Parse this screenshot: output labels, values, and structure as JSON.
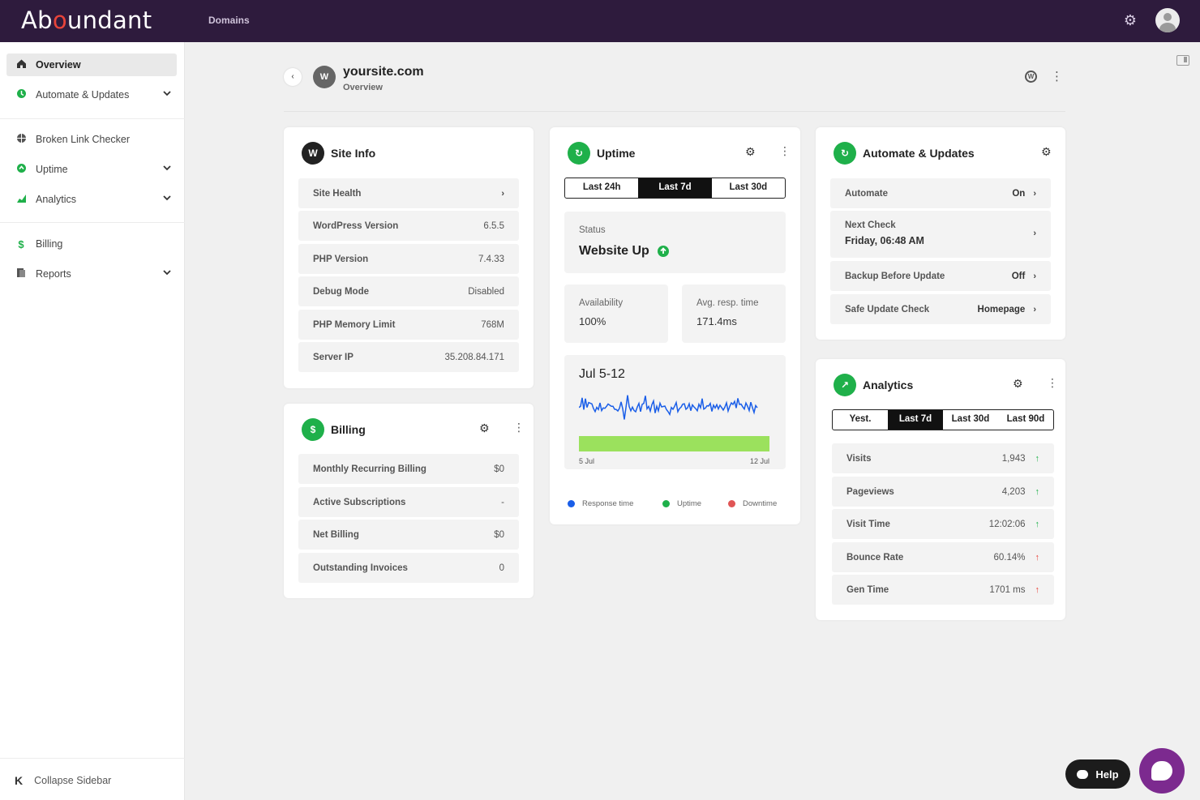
{
  "topbar": {
    "logo": "Abundant",
    "logo_pre": "Ab",
    "logo_o": "o",
    "logo_post": "undant",
    "nav": "Domains",
    "gear": "⚙"
  },
  "sidebar": {
    "overview": "Overview",
    "automate": "Automate & Updates",
    "blc": "Broken Link Checker",
    "uptime": "Uptime",
    "analytics": "Analytics",
    "billing": "Billing",
    "reports": "Reports",
    "collapse": "Collapse Sidebar"
  },
  "header": {
    "back": "‹",
    "avatar": "W",
    "site": "yoursite.com",
    "sub": "Overview",
    "kebab": "⋮"
  },
  "site_info": {
    "title": "Site Info",
    "rows": [
      {
        "label": "Site Health",
        "value": ""
      },
      {
        "label": "WordPress Version",
        "value": "6.5.5"
      },
      {
        "label": "PHP Version",
        "value": "7.4.33"
      },
      {
        "label": "Debug Mode",
        "value": "Disabled"
      },
      {
        "label": "PHP Memory Limit",
        "value": "768M"
      },
      {
        "label": "Server IP",
        "value": "35.208.84.171"
      }
    ]
  },
  "billing": {
    "title": "Billing",
    "rows": [
      {
        "label": "Monthly Recurring Billing",
        "value": "$0"
      },
      {
        "label": "Active Subscriptions",
        "value": "-"
      },
      {
        "label": "Net Billing",
        "value": "$0"
      },
      {
        "label": "Outstanding Invoices",
        "value": "0"
      }
    ]
  },
  "uptime": {
    "title": "Uptime",
    "tabs": [
      "Last 24h",
      "Last 7d",
      "Last 30d"
    ],
    "active_tab": "Last 7d",
    "status_label": "Status",
    "status_value": "Website Up",
    "availability_label": "Availability",
    "availability_value": "100%",
    "resp_label": "Avg. resp. time",
    "resp_value": "171.4ms",
    "chart_title": "Jul 5-12",
    "x_start": "5 Jul",
    "x_end": "12 Jul",
    "legend": [
      "Response time",
      "Uptime",
      "Downtime"
    ],
    "colors": {
      "response": "#1a5ee8",
      "uptime": "#9be15d",
      "downtime": "#e05555"
    }
  },
  "automate": {
    "title": "Automate & Updates",
    "rows": [
      {
        "label": "Automate",
        "value": "On"
      },
      {
        "label": "Next Check",
        "value": "Friday, 06:48 AM"
      },
      {
        "label": "Backup Before Update",
        "value": "Off"
      },
      {
        "label": "Safe Update Check",
        "value": "Homepage"
      }
    ]
  },
  "analytics": {
    "title": "Analytics",
    "tabs": [
      "Yest.",
      "Last 7d",
      "Last 30d",
      "Last 90d"
    ],
    "active_tab": "Last 7d",
    "rows": [
      {
        "label": "Visits",
        "value": "1,943",
        "trend": "up"
      },
      {
        "label": "Pageviews",
        "value": "4,203",
        "trend": "up"
      },
      {
        "label": "Visit Time",
        "value": "12:02:06",
        "trend": "up"
      },
      {
        "label": "Bounce Rate",
        "value": "60.14%",
        "trend": "up-red"
      },
      {
        "label": "Gen Time",
        "value": "1701 ms",
        "trend": "up-red"
      }
    ]
  },
  "help": {
    "label": "Help"
  }
}
